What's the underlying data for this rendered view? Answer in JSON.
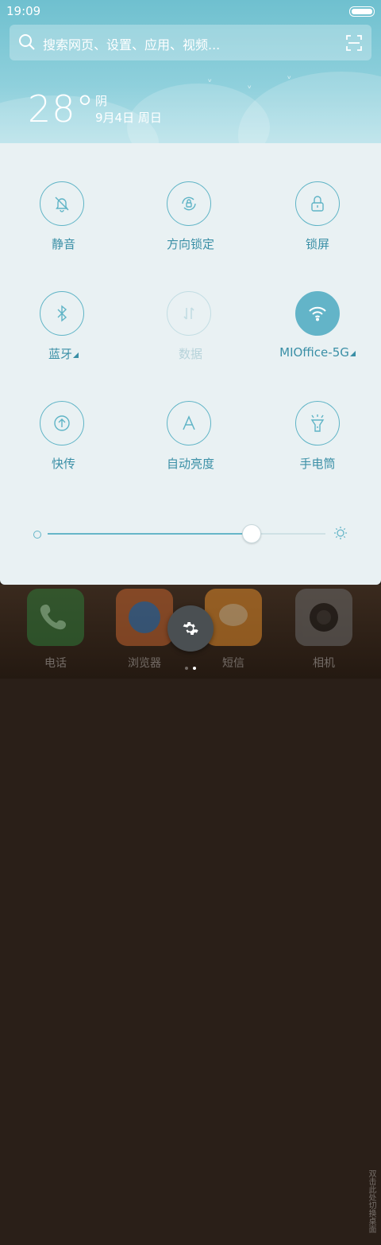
{
  "status_bar": {
    "time": "19:09"
  },
  "search": {
    "placeholder": "搜索网页、设置、应用、视频..."
  },
  "weather": {
    "temperature": "28°",
    "condition": "阴",
    "date": "9月4日 周日"
  },
  "toggles": [
    {
      "label": "静音",
      "icon": "bell-off-icon",
      "state": "off"
    },
    {
      "label": "方向锁定",
      "icon": "rotation-lock-icon",
      "state": "off"
    },
    {
      "label": "锁屏",
      "icon": "lock-icon",
      "state": "off"
    },
    {
      "label": "蓝牙",
      "icon": "bluetooth-icon",
      "state": "off"
    },
    {
      "label": "数据",
      "icon": "data-icon",
      "state": "disabled"
    },
    {
      "label": "MIOffice-5G",
      "icon": "wifi-icon",
      "state": "on"
    },
    {
      "label": "快传",
      "icon": "upload-icon",
      "state": "off"
    },
    {
      "label": "自动亮度",
      "icon": "auto-brightness-icon",
      "state": "off"
    },
    {
      "label": "手电筒",
      "icon": "flashlight-icon",
      "state": "off"
    }
  ],
  "brightness": {
    "level": 0.73
  },
  "dock": {
    "apps": [
      {
        "label": "电话",
        "icon": "phone-icon"
      },
      {
        "label": "浏览器",
        "icon": "browser-icon"
      },
      {
        "label": "短信",
        "icon": "message-icon"
      },
      {
        "label": "相机",
        "icon": "camera-icon"
      }
    ],
    "side_hint": "双击此处切换桌面"
  },
  "settings_button": {
    "icon": "gear-icon"
  },
  "colors": {
    "accent": "#63b4c8",
    "panel_bg": "#e9f1f3",
    "header_bg": "#6fc0cf"
  }
}
